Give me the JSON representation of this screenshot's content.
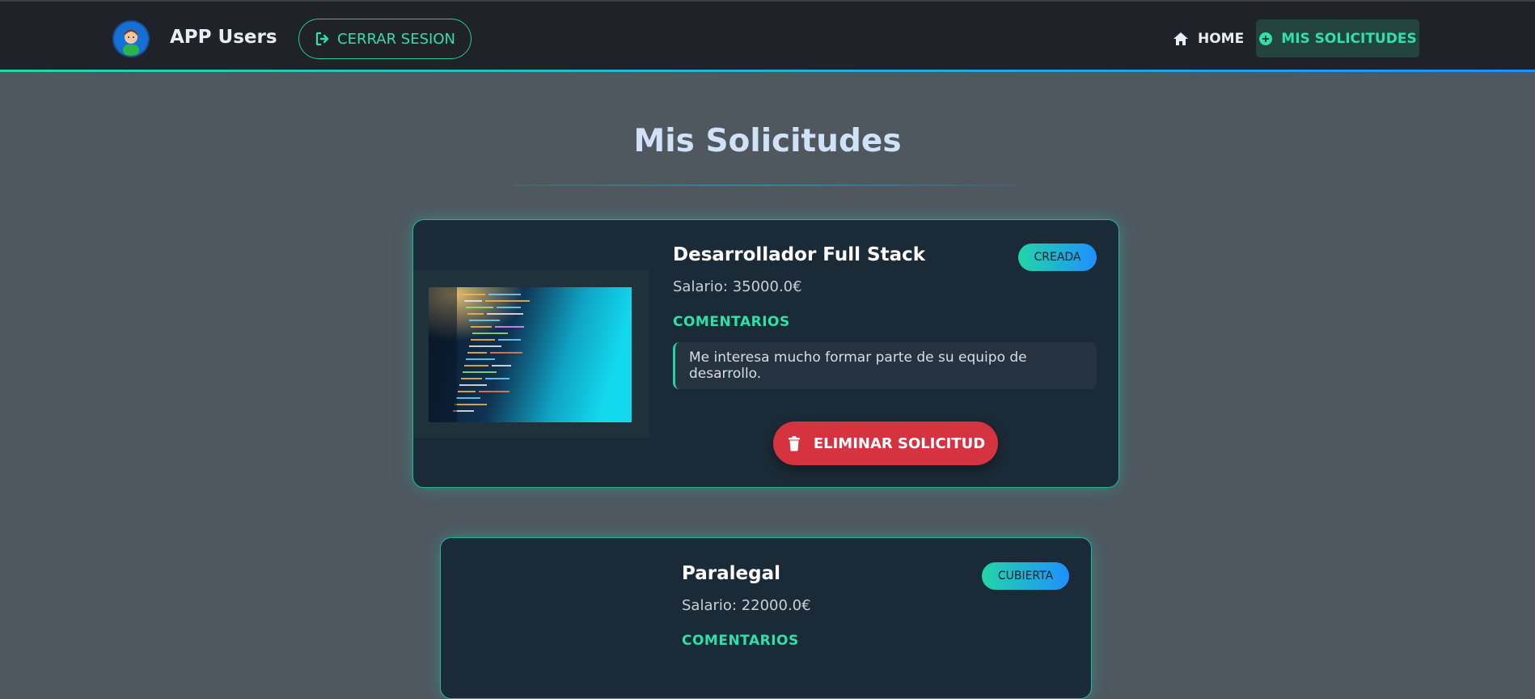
{
  "header": {
    "brand": "APP Users",
    "logout_label": "CERRAR SESION",
    "nav": {
      "home_label": "HOME",
      "requests_label": "MIS SOLICITUDES"
    }
  },
  "page": {
    "title": "Mis Solicitudes"
  },
  "requests": [
    {
      "job_title": "Desarrollador Full Stack",
      "salary": "Salario: 35000.0€",
      "status": "CREADA",
      "comments_label": "COMENTARIOS",
      "comment": "Me interesa mucho formar parte de su equipo de desarrollo.",
      "delete_label": "ELIMINAR SOLICITUD"
    },
    {
      "job_title": "Paralegal",
      "salary": "Salario: 22000.0€",
      "status": "CUBIERTA",
      "comments_label": "COMENTARIOS"
    }
  ],
  "colors": {
    "accent": "#23d5a6",
    "accent_blue": "#1e90ff",
    "danger": "#d63341",
    "background": "#4f575f",
    "navbar": "#1f2329",
    "card": "#1b2a37"
  },
  "icons": {
    "avatar": "user-avatar-icon",
    "logout": "sign-out-icon",
    "home": "home-icon",
    "requests": "plus-circle-icon",
    "delete": "trash-icon"
  }
}
